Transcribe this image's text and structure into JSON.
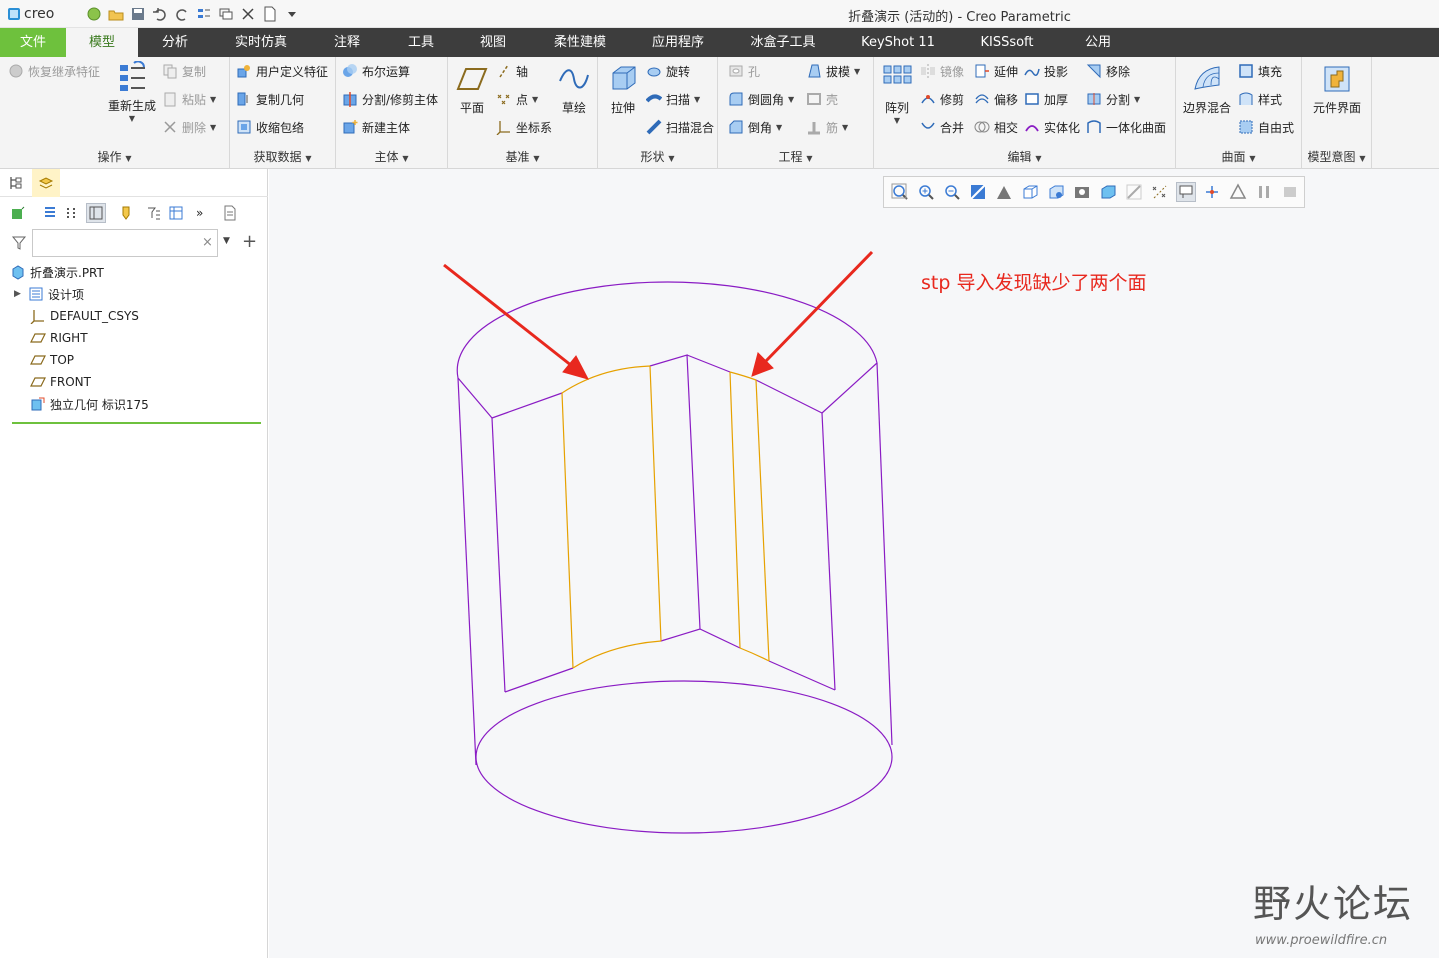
{
  "app": {
    "logo": "creo",
    "window_title": "折叠演示 (活动的) - Creo Parametric"
  },
  "tabs": [
    "文件",
    "模型",
    "分析",
    "实时仿真",
    "注释",
    "工具",
    "视图",
    "柔性建模",
    "应用程序",
    "冰盒子工具",
    "KeyShot 11",
    "KISSsoft",
    "公用"
  ],
  "ribbon": {
    "operations": {
      "label": "操作",
      "restore": "恢复继承特征",
      "regenerate": "重新生成",
      "copy": "复制",
      "paste": "粘贴",
      "delete": "删除"
    },
    "get_data": {
      "label": "获取数据",
      "udf": "用户定义特征",
      "copy_geom": "复制几何",
      "shrinkwrap": "收缩包络"
    },
    "body": {
      "label": "主体",
      "boolean": "布尔运算",
      "split": "分割/修剪主体",
      "new_body": "新建主体"
    },
    "datum": {
      "label": "基准",
      "plane": "平面",
      "axis": "轴",
      "point": "点",
      "csys": "坐标系",
      "sketch": "草绘"
    },
    "shapes": {
      "label": "形状",
      "extrude": "拉伸",
      "revolve": "旋转",
      "sweep": "扫描",
      "swept_blend": "扫描混合"
    },
    "engineering": {
      "label": "工程",
      "hole": "孔",
      "round": "倒圆角",
      "chamfer": "倒角",
      "draft": "拔模",
      "shell": "壳",
      "rib": "筋"
    },
    "editing": {
      "label": "编辑",
      "pattern": "阵列",
      "mirror": "镜像",
      "extend": "延伸",
      "project": "投影",
      "remove": "移除",
      "trim": "修剪",
      "offset": "偏移",
      "thicken": "加厚",
      "split": "分割",
      "merge": "合并",
      "intersect": "相交",
      "solidify": "实体化",
      "unify": "一体化曲面"
    },
    "surfaces": {
      "label": "曲面",
      "boundary": "边界混合",
      "fill": "填充",
      "style": "样式",
      "freeform": "自由式"
    },
    "model_intent": {
      "label": "模型意图",
      "component_interface": "元件界面"
    }
  },
  "tree": {
    "filter_placeholder": "",
    "root": "折叠演示.PRT",
    "items": [
      {
        "label": "设计项",
        "icon": "design-items-icon"
      },
      {
        "label": "DEFAULT_CSYS",
        "icon": "csys-icon"
      },
      {
        "label": "RIGHT",
        "icon": "datum-plane-icon"
      },
      {
        "label": "TOP",
        "icon": "datum-plane-icon"
      },
      {
        "label": "FRONT",
        "icon": "datum-plane-icon"
      },
      {
        "label": "独立几何 标识175",
        "icon": "independent-geometry-icon"
      }
    ]
  },
  "canvas": {
    "annotation": "stp 导入发现缺少了两个面",
    "watermark_title": "野火论坛",
    "watermark_url": "www.proewildfire.cn"
  },
  "colors": {
    "tab_active_green": "#6ec13d",
    "edge_purple": "#8a1cc4",
    "edge_orange": "#e6a100",
    "arrow_red": "#e8281e"
  }
}
